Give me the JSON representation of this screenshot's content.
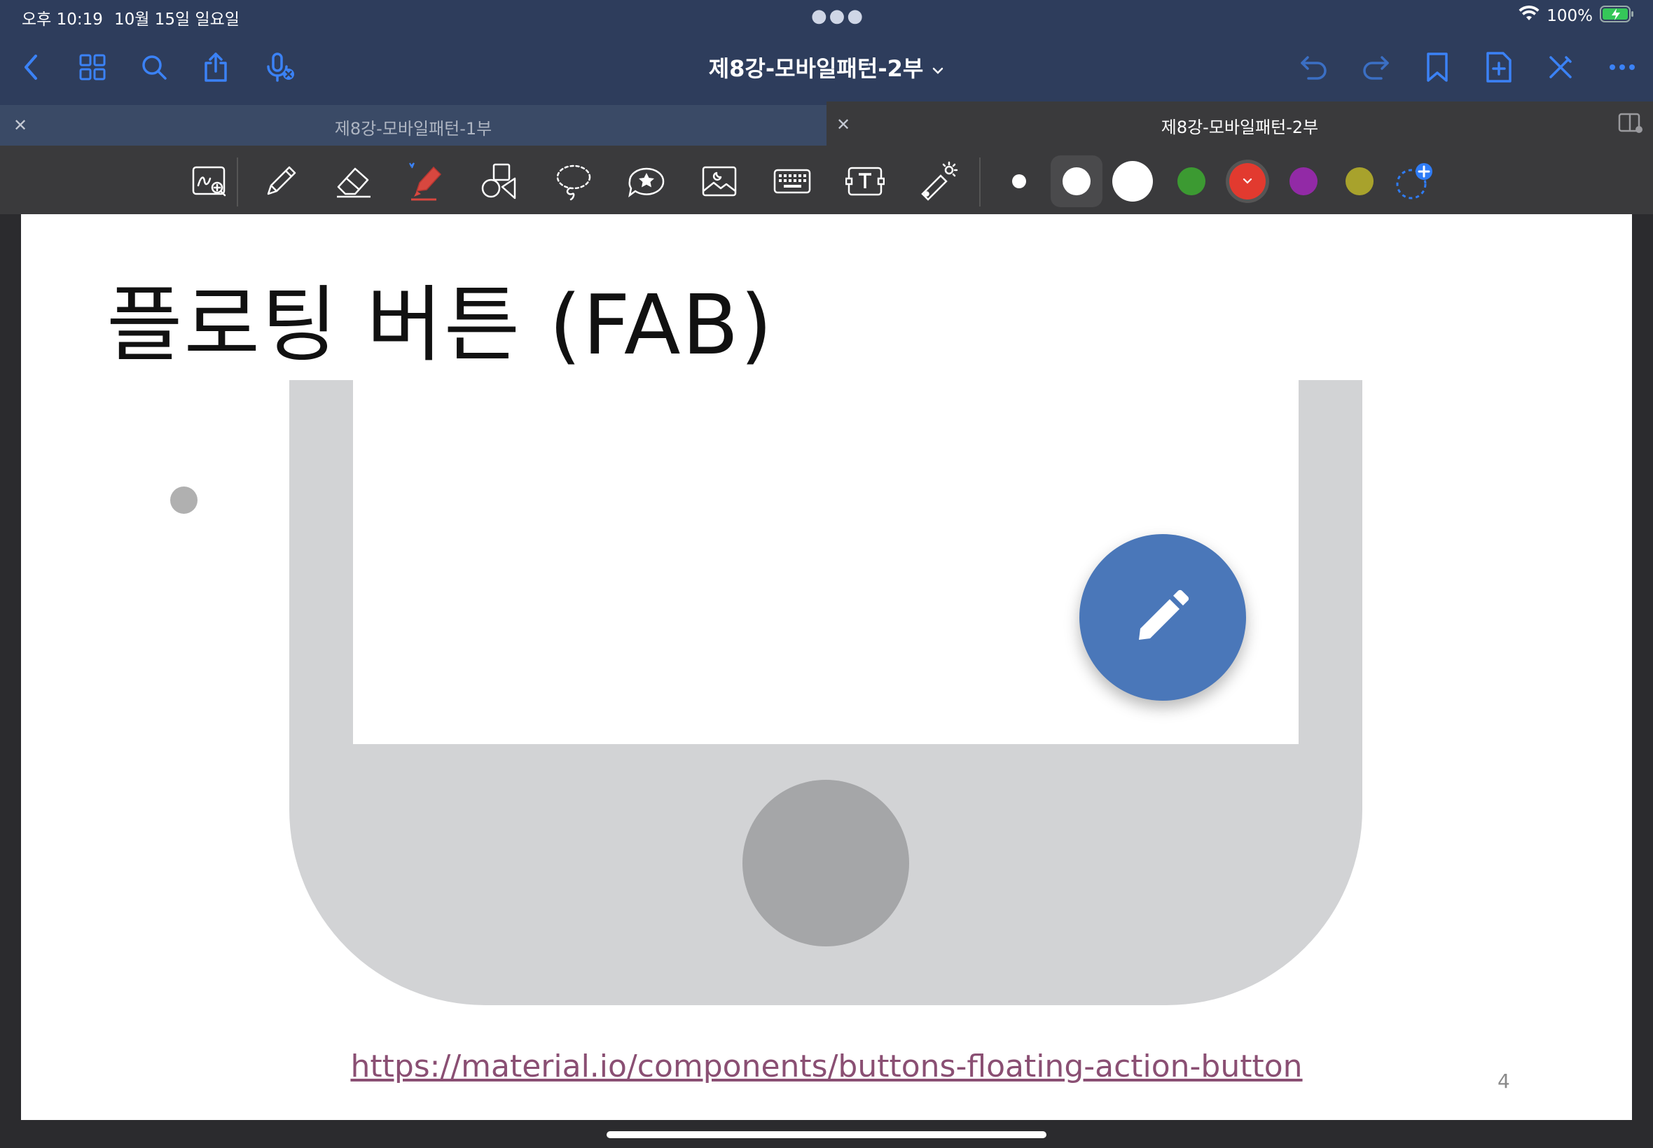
{
  "status_bar": {
    "time": "오후 10:19",
    "date": "10월 15일 일요일",
    "battery": "100%"
  },
  "nav": {
    "doc_title": "제8강-모바일패턴-2부",
    "icons": [
      "back-icon",
      "grid-icon",
      "search-icon",
      "share-icon",
      "mic-off-icon",
      "undo-icon",
      "redo-icon",
      "bookmark-icon",
      "add-page-icon",
      "pen-off-icon",
      "more-icon"
    ]
  },
  "tabs": [
    {
      "label": "제8강-모바일패턴-1부",
      "active": false
    },
    {
      "label": "제8강-모바일패턴-2부",
      "active": true
    }
  ],
  "toolbar": {
    "tools": [
      "zoom-write-icon",
      "pencil-icon",
      "eraser-icon",
      "highlighter-icon",
      "shapes-icon",
      "lasso-icon",
      "sticker-icon",
      "image-icon",
      "keyboard-icon",
      "textbox-icon",
      "laser-pointer-icon"
    ],
    "colors": {
      "white": "#ffffff",
      "green": "#3c9a32",
      "red": "#e23a2f",
      "purple": "#922aa6",
      "olive": "#a8a22c",
      "accent": "#2f7cf6"
    }
  },
  "slide": {
    "title": "플로팅 버튼 (FAB)",
    "link": "https://material.io/components/buttons-floating-action-button",
    "page_number": "4",
    "colors": {
      "fab": "#4a77b9",
      "phone": "#d2d3d5",
      "home_button": "#a5a6a8",
      "link": "#8a4f73"
    }
  }
}
